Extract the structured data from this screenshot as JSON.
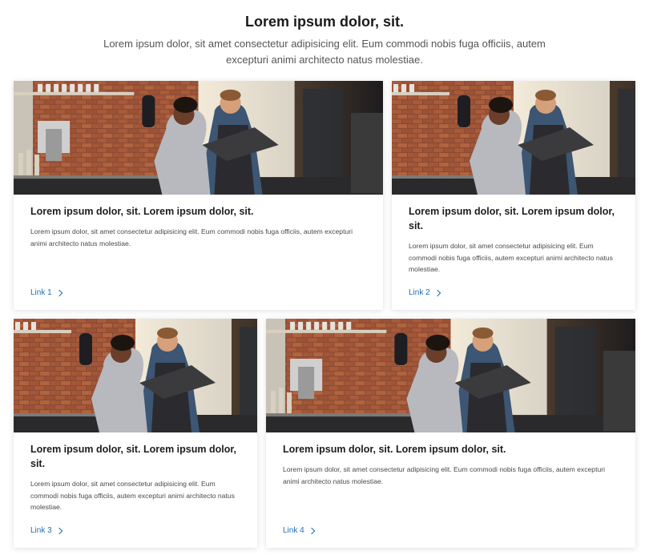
{
  "header": {
    "title": "Lorem ipsum dolor, sit.",
    "subtitle": "Lorem ipsum dolor, sit amet consectetur adipisicing elit. Eum commodi nobis fuga officiis, autem excepturi animi architecto natus molestiae."
  },
  "cards": [
    {
      "title": "Lorem ipsum dolor, sit. Lorem ipsum dolor, sit.",
      "desc": "Lorem ipsum dolor, sit amet consectetur adipisicing elit. Eum commodi nobis fuga officiis, autem excepturi animi architecto natus molestiae.",
      "link": "Link 1"
    },
    {
      "title": "Lorem ipsum dolor, sit. Lorem ipsum dolor, sit.",
      "desc": "Lorem ipsum dolor, sit amet consectetur adipisicing elit. Eum commodi nobis fuga officiis, autem excepturi animi architecto natus molestiae.",
      "link": "Link 2"
    },
    {
      "title": "Lorem ipsum dolor, sit. Lorem ipsum dolor, sit.",
      "desc": "Lorem ipsum dolor, sit amet consectetur adipisicing elit. Eum commodi nobis fuga officiis, autem excepturi animi architecto natus molestiae.",
      "link": "Link 3"
    },
    {
      "title": "Lorem ipsum dolor, sit. Lorem ipsum dolor, sit.",
      "desc": "Lorem ipsum dolor, sit amet consectetur adipisicing elit. Eum commodi nobis fuga officiis, autem excepturi animi architecto natus molestiae.",
      "link": "Link 4"
    }
  ],
  "colors": {
    "link": "#1d6fb3",
    "title": "#1d1d1d",
    "text": "#4a4a4a"
  }
}
